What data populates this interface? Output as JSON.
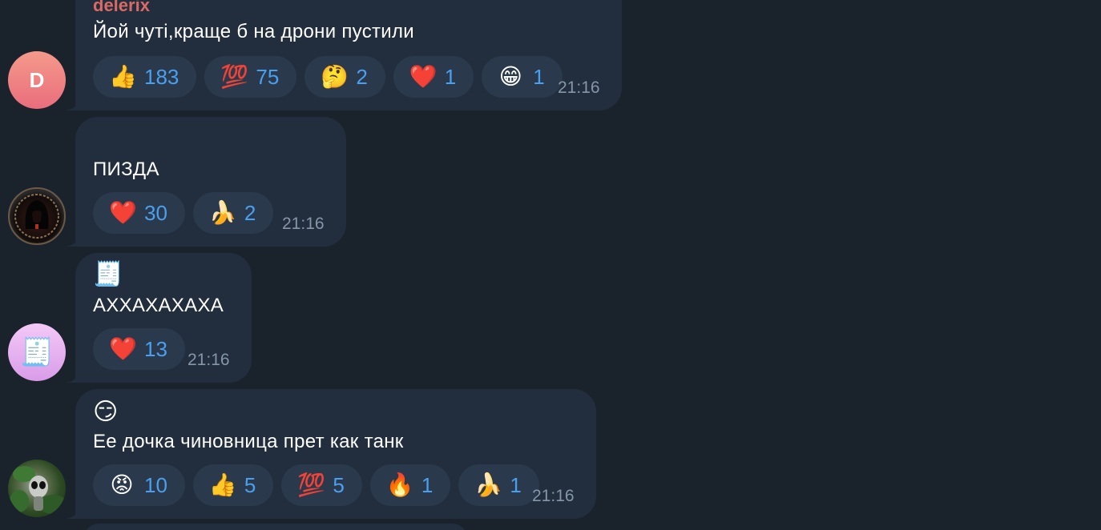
{
  "messages": [
    {
      "avatar_letter": "D",
      "sender": "delerix",
      "text": "Йой чуті,краще б на дрони пустили",
      "time": "21:16",
      "reactions": [
        {
          "emoji": "👍",
          "icon": "thumbs-up-icon",
          "count": "183"
        },
        {
          "emoji": "💯",
          "icon": "hundred-points-icon",
          "count": "75"
        },
        {
          "emoji": "🤔",
          "icon": "thinking-face-icon",
          "count": "2"
        },
        {
          "emoji": "❤️",
          "icon": "red-heart-icon",
          "count": "1"
        },
        {
          "emoji": "😁",
          "icon": "beaming-face-icon",
          "count": "1"
        }
      ]
    },
    {
      "text": "ПИЗДА",
      "time": "21:16",
      "reactions": [
        {
          "emoji": "❤️",
          "icon": "red-heart-icon",
          "count": "30"
        },
        {
          "emoji": "🍌",
          "icon": "banana-icon",
          "count": "2"
        }
      ]
    },
    {
      "sticker": "🧾",
      "text": "АХХАХАХАХА",
      "time": "21:16",
      "reactions": [
        {
          "emoji": "❤️",
          "icon": "red-heart-icon",
          "count": "13"
        }
      ]
    },
    {
      "sticker": "😏",
      "text": "Ее дочка чиновница прет как танк",
      "time": "21:16",
      "reactions": [
        {
          "emoji": "😡",
          "icon": "angry-face-icon",
          "count": "10"
        },
        {
          "emoji": "👍",
          "icon": "thumbs-up-icon",
          "count": "5"
        },
        {
          "emoji": "💯",
          "icon": "hundred-points-icon",
          "count": "5"
        },
        {
          "emoji": "🔥",
          "icon": "fire-icon",
          "count": "1"
        },
        {
          "emoji": "🍌",
          "icon": "banana-icon",
          "count": "1"
        }
      ]
    }
  ],
  "colors": {
    "background": "#1a222c",
    "bubble": "#222e3e",
    "reaction_chip": "#2a394b",
    "reaction_count": "#4aa0f0",
    "sender_name": "#d96a64",
    "timestamp": "#8496a8"
  }
}
